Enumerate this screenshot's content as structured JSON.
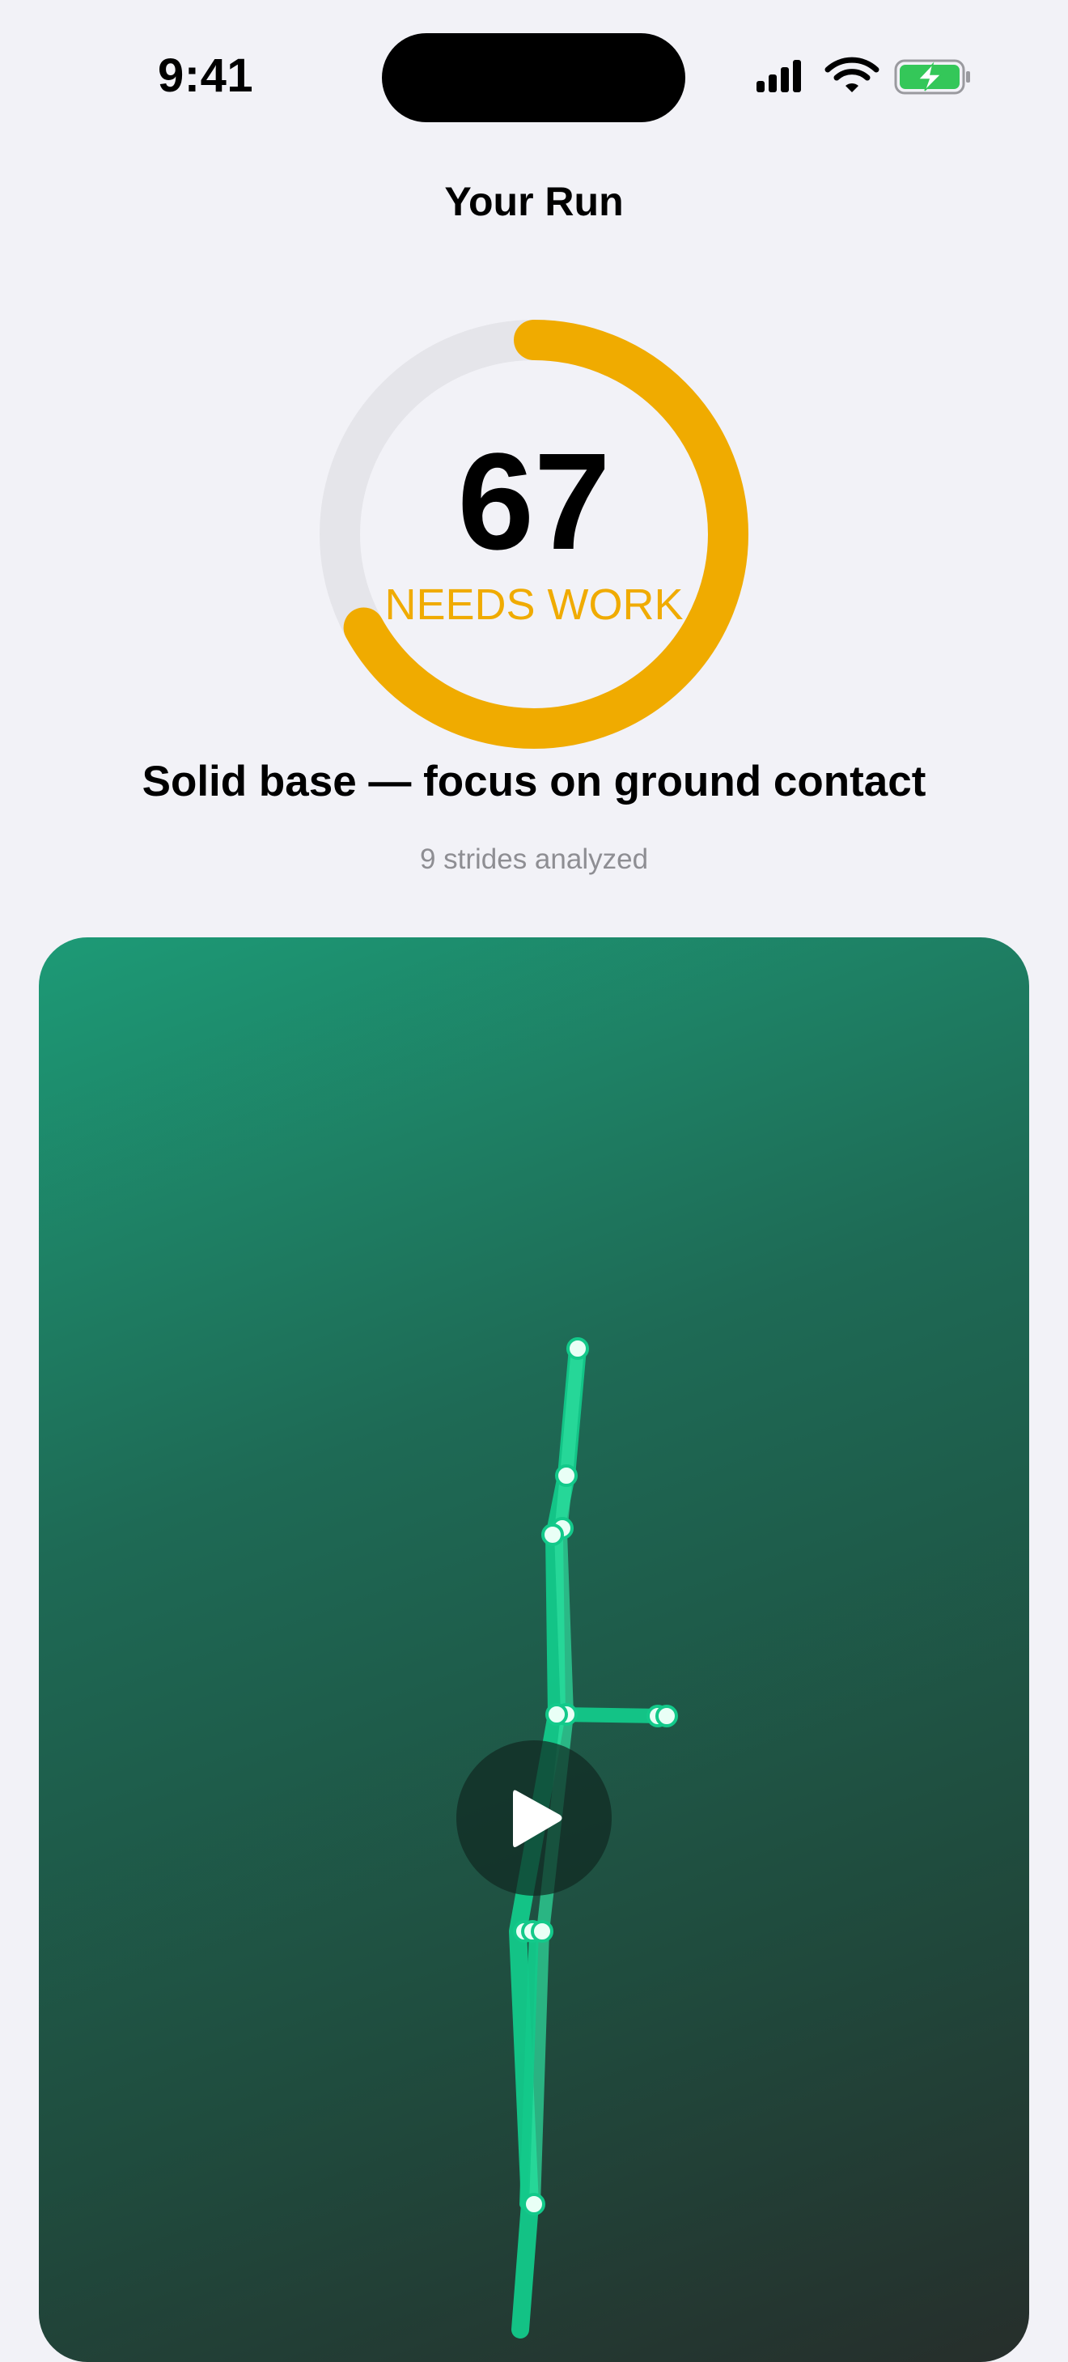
{
  "status_bar": {
    "time": "9:41"
  },
  "screen": {
    "title": "Your Run"
  },
  "score": {
    "value": "67",
    "progress": 0.67,
    "label": "NEEDS WORK",
    "accent_color": "#f0ab00",
    "track_color": "#e5e5ea"
  },
  "summary": {
    "headline": "Solid base — focus on ground contact",
    "strides_text": "9 strides analyzed"
  },
  "video": {
    "state": "paused",
    "play_icon": "play-icon",
    "skeleton_color": "#13c98a"
  },
  "colors": {
    "background": "#f2f2f7",
    "battery_fill": "#34c759"
  }
}
